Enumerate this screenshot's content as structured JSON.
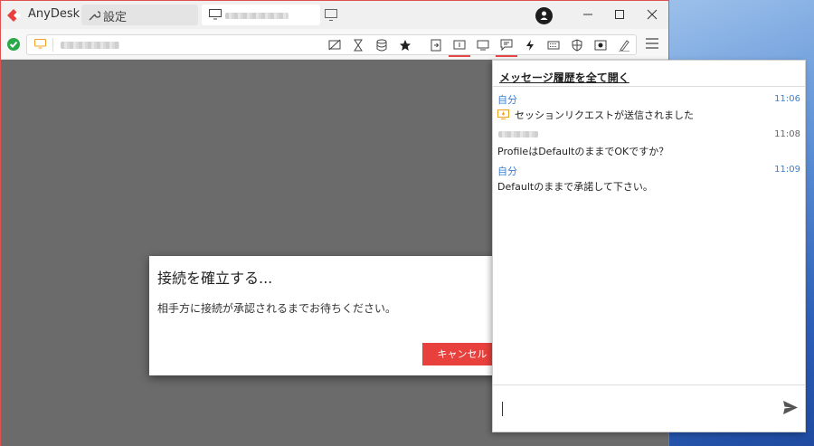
{
  "app": {
    "name": "AnyDesk"
  },
  "tabs": {
    "settings_label": "設定"
  },
  "colors": {
    "brand": "#e8403c",
    "link": "#3a7fd0",
    "status_ok": "#2aa84a"
  },
  "toolbar": {
    "icons": [
      "hide-display-icon",
      "hourglass-icon",
      "database-icon",
      "star-icon",
      "file-transfer-icon",
      "monitor-switch-icon",
      "display-icon",
      "chat-icon",
      "action-icon",
      "keyboard-icon",
      "permissions-icon",
      "screenshot-icon",
      "whiteboard-icon",
      "menu-icon"
    ]
  },
  "dialog": {
    "title": "接続を確立する...",
    "message": "相手方に接続が承認されるまでお待ちください。",
    "cancel_label": "キャンセル"
  },
  "chat": {
    "header": "メッセージ履歴を全て開く",
    "messages": [
      {
        "sender": "自分",
        "time": "11:06",
        "text": "セッションリクエストが送信されました"
      },
      {
        "time": "11:08",
        "text": "ProfileはDefaultのままでOKですか？"
      },
      {
        "sender": "自分",
        "time": "11:09",
        "text": "Defaultのままで承諾して下さい。"
      }
    ]
  }
}
